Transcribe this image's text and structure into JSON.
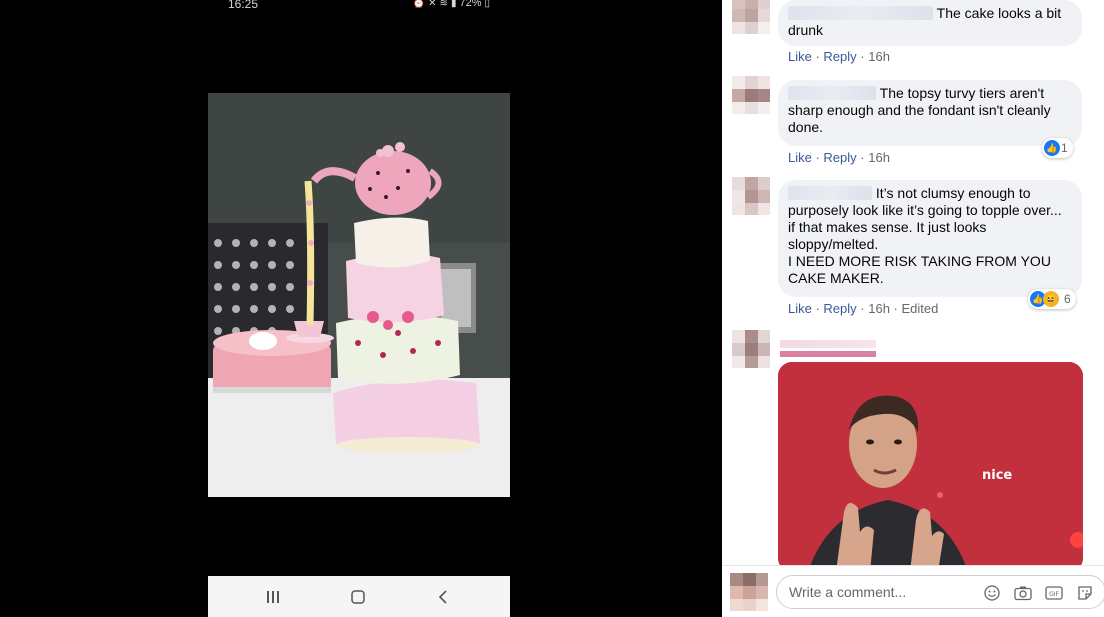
{
  "phone": {
    "status_time": "16:25",
    "battery": "72%"
  },
  "comments": [
    {
      "text": "The cake looks a bit drunk",
      "actions": {
        "like": "Like",
        "reply": "Reply",
        "time": "16h"
      }
    },
    {
      "text": "The topsy turvy tiers aren't sharp enough and the fondant isn't cleanly done.",
      "actions": {
        "like": "Like",
        "reply": "Reply",
        "time": "16h"
      },
      "reactions": {
        "icons": [
          "like-icon"
        ],
        "count": "1"
      }
    },
    {
      "text": "It’s not clumsy enough to purposely look like it’s going to topple over... if that makes sense. It just looks sloppy/melted.",
      "text2": "I NEED MORE RISK TAKING FROM YOU CAKE MAKER.",
      "actions": {
        "like": "Like",
        "reply": "Reply",
        "time": "16h",
        "edited": "Edited"
      },
      "reactions": {
        "icons": [
          "like-icon",
          "haha-icon"
        ],
        "count": "6"
      }
    },
    {
      "gif_caption": "nice"
    }
  ],
  "composer": {
    "placeholder": "Write a comment...",
    "icons": [
      "emoji-icon",
      "camera-icon",
      "gif-icon",
      "sticker-icon"
    ]
  },
  "colors": {
    "link": "#385898",
    "meta": "#65676b",
    "bubble": "#f0f2f5",
    "gif_bg": "#c2303e",
    "fb_blue": "#1877f2"
  }
}
